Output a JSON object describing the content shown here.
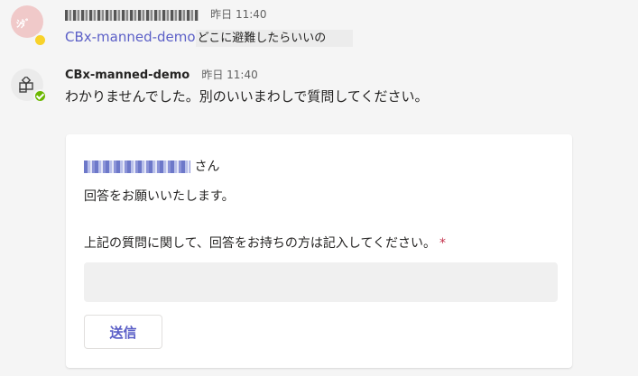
{
  "message1": {
    "avatar_initials": "ｼﾀﾞ",
    "author_obscured": "",
    "timestamp": "昨日 11:40",
    "mention": "CBx-manned-demo",
    "text": "どこに避難したらいいの"
  },
  "message2": {
    "author": "CBx-manned-demo",
    "timestamp": "昨日 11:40",
    "text": "わかりませんでした。別のいいまわしで質問してください。"
  },
  "card": {
    "user_suffix": "さん",
    "request": "回答をお願いいたします。",
    "question": "上記の質問に関して、回答をお持ちの方は記入してください。",
    "required_mark": "*",
    "answer_value": "",
    "submit_label": "送信"
  }
}
